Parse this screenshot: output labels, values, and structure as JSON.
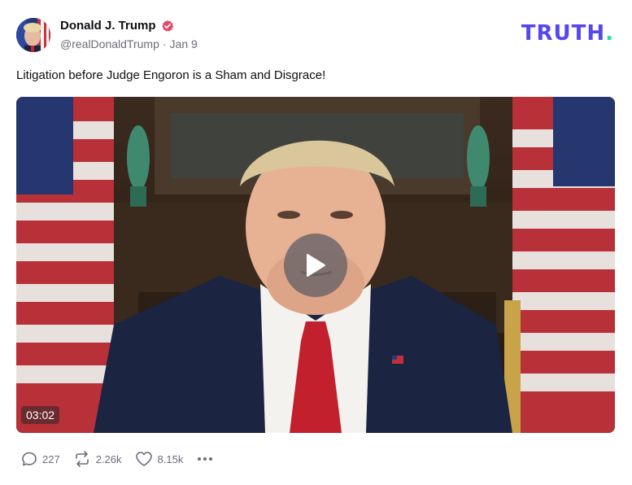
{
  "author": {
    "display_name": "Donald J. Trump",
    "handle": "@realDonaldTrump",
    "separator": "·",
    "date": "Jan 9",
    "verified": true
  },
  "brand": {
    "logo_text": "TRUTH",
    "logo_dot": "."
  },
  "post": {
    "text": "Litigation before Judge Engoron is a Sham and Disgrace!"
  },
  "video": {
    "duration": "03:02"
  },
  "actions": {
    "replies": "227",
    "retruths": "2.26k",
    "likes": "8.15k"
  },
  "icons": {
    "verified": "verified-badge-icon",
    "reply": "reply-icon",
    "retruth": "retruth-icon",
    "like": "heart-icon",
    "more": "more-icon",
    "play": "play-icon"
  },
  "colors": {
    "brand": "#5448ee",
    "brand_dot": "#17e3a3",
    "verified": "#e24967",
    "muted": "#6b6b7b"
  }
}
